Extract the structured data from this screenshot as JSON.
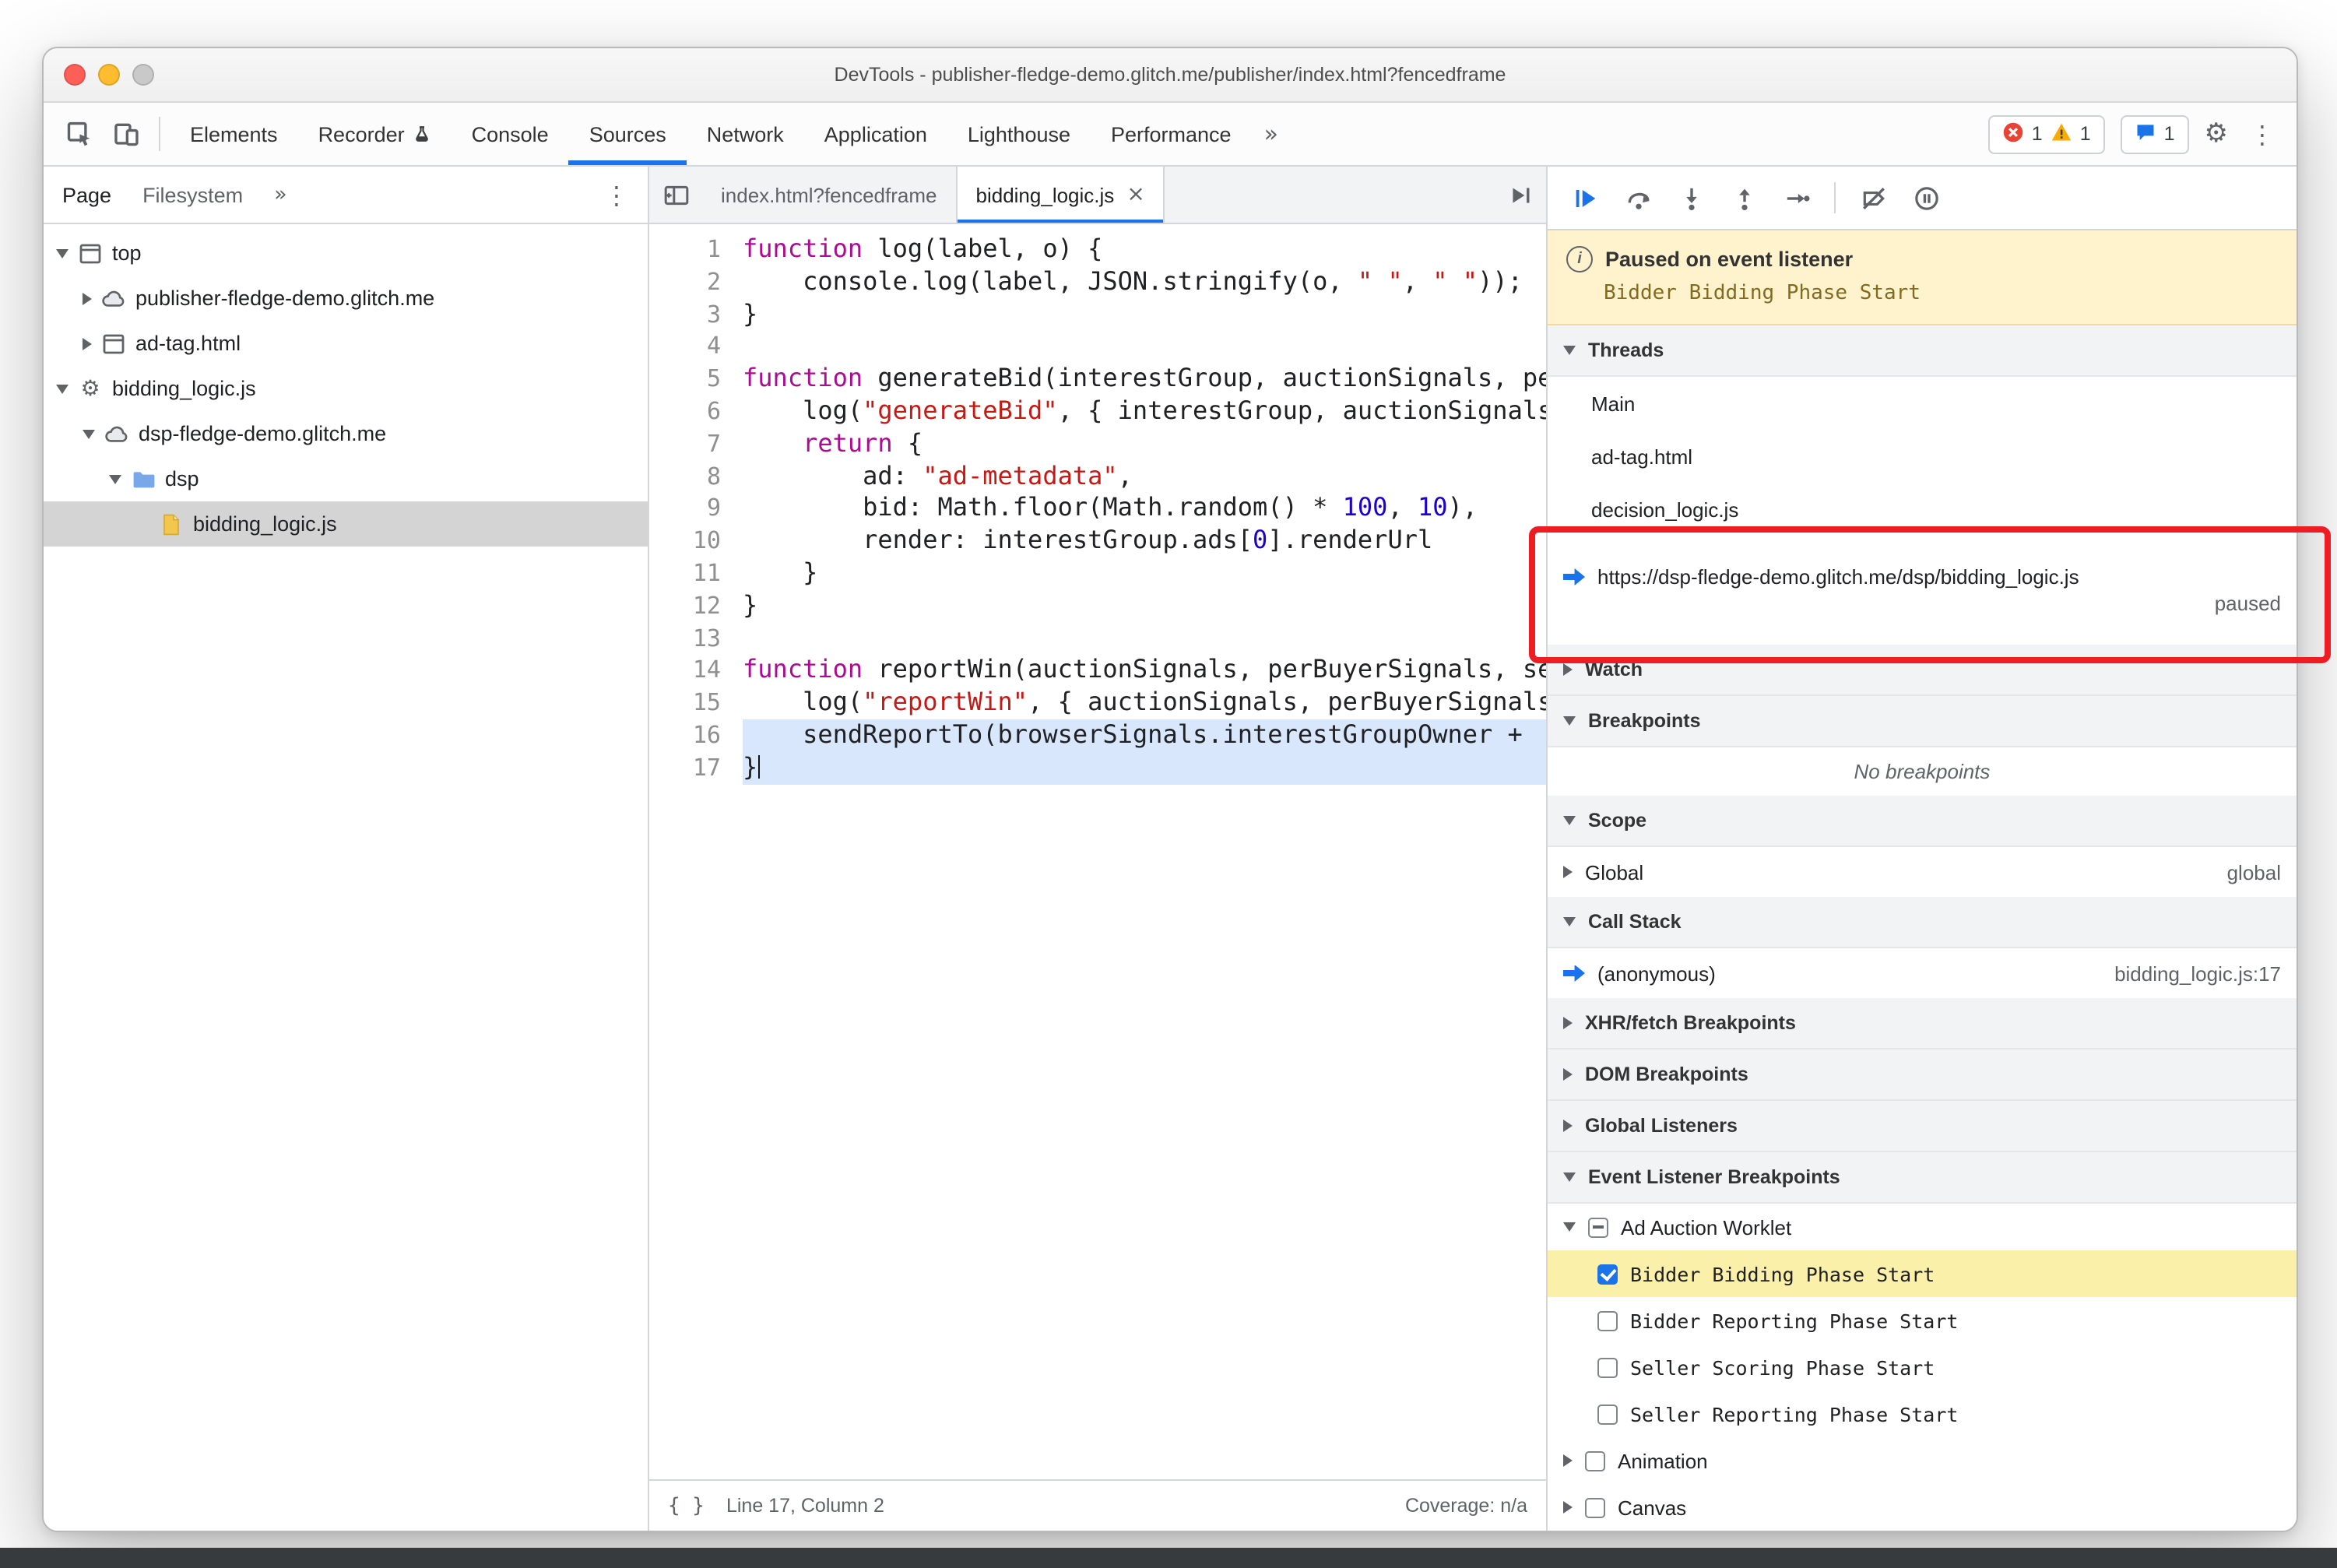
{
  "window": {
    "title": "DevTools - publisher-fledge-demo.glitch.me/publisher/index.html?fencedframe"
  },
  "colors": {
    "accent": "#1a73e8",
    "annotation_red": "#ee1d23",
    "paused_banner_bg": "#fff3cd",
    "highlight_yellow": "#fbf0a9",
    "paused_line_blue": "#d9e7fd"
  },
  "icons": {
    "settings": "⚙",
    "kebab": "⋮",
    "info": "i",
    "close_tab": "×",
    "pretty_print": "{ }"
  },
  "main_toolbar": {
    "tabs": [
      {
        "label": "Elements"
      },
      {
        "label": "Recorder",
        "badge": "flask"
      },
      {
        "label": "Console"
      },
      {
        "label": "Sources",
        "active": true
      },
      {
        "label": "Network"
      },
      {
        "label": "Application"
      },
      {
        "label": "Lighthouse"
      },
      {
        "label": "Performance"
      }
    ],
    "more": "»",
    "errors": "1",
    "warnings": "1",
    "issues": "1"
  },
  "navigator": {
    "tabs": [
      {
        "label": "Page",
        "active": true
      },
      {
        "label": "Filesystem"
      }
    ],
    "more": "»",
    "tree": [
      {
        "label": "top",
        "indent": 0,
        "twisty": "open",
        "icon": "frame"
      },
      {
        "label": "publisher-fledge-demo.glitch.me",
        "indent": 1,
        "twisty": "closed",
        "icon": "cloud"
      },
      {
        "label": "ad-tag.html",
        "indent": 1,
        "twisty": "closed",
        "icon": "frame"
      },
      {
        "label": "bidding_logic.js",
        "indent": 0,
        "twisty": "open",
        "icon": "gear"
      },
      {
        "label": "dsp-fledge-demo.glitch.me",
        "indent": 1,
        "twisty": "open",
        "icon": "cloud"
      },
      {
        "label": "dsp",
        "indent": 2,
        "twisty": "open",
        "icon": "folder"
      },
      {
        "label": "bidding_logic.js",
        "indent": 3,
        "twisty": "none",
        "icon": "file",
        "selected": true
      }
    ]
  },
  "editor": {
    "tabs": [
      {
        "label": "index.html?fencedframe"
      },
      {
        "label": "bidding_logic.js",
        "active": true,
        "closable": true
      }
    ],
    "status": {
      "line_col": "Line 17, Column 2",
      "coverage": "Coverage: n/a"
    },
    "code": [
      {
        "n": 1,
        "tokens": [
          {
            "c": "k",
            "t": "function"
          },
          {
            "c": "p",
            "t": " log(label, o) {"
          }
        ]
      },
      {
        "n": 2,
        "tokens": [
          {
            "c": "p",
            "t": "    console.log(label, JSON.stringify(o, "
          },
          {
            "c": "s",
            "t": "\" \""
          },
          {
            "c": "p",
            "t": ", "
          },
          {
            "c": "s",
            "t": "\" \""
          },
          {
            "c": "p",
            "t": "));"
          }
        ]
      },
      {
        "n": 3,
        "tokens": [
          {
            "c": "p",
            "t": "}"
          }
        ]
      },
      {
        "n": 4,
        "tokens": []
      },
      {
        "n": 5,
        "tokens": [
          {
            "c": "k",
            "t": "function"
          },
          {
            "c": "p",
            "t": " generateBid(interestGroup, auctionSignals, perBuyerSign"
          }
        ]
      },
      {
        "n": 6,
        "tokens": [
          {
            "c": "p",
            "t": "    log("
          },
          {
            "c": "s",
            "t": "\"generateBid\""
          },
          {
            "c": "p",
            "t": ", { interestGroup, auctionSignals, perBu"
          }
        ]
      },
      {
        "n": 7,
        "tokens": [
          {
            "c": "p",
            "t": "    "
          },
          {
            "c": "k",
            "t": "return"
          },
          {
            "c": "p",
            "t": " {"
          }
        ]
      },
      {
        "n": 8,
        "tokens": [
          {
            "c": "p",
            "t": "        ad: "
          },
          {
            "c": "s",
            "t": "\"ad-metadata\""
          },
          {
            "c": "p",
            "t": ","
          }
        ]
      },
      {
        "n": 9,
        "tokens": [
          {
            "c": "p",
            "t": "        bid: Math.floor(Math.random() * "
          },
          {
            "c": "n",
            "t": "100"
          },
          {
            "c": "p",
            "t": ", "
          },
          {
            "c": "n",
            "t": "10"
          },
          {
            "c": "p",
            "t": "),"
          }
        ]
      },
      {
        "n": 10,
        "tokens": [
          {
            "c": "p",
            "t": "        render: interestGroup.ads["
          },
          {
            "c": "n",
            "t": "0"
          },
          {
            "c": "p",
            "t": "].renderUrl"
          }
        ]
      },
      {
        "n": 11,
        "tokens": [
          {
            "c": "p",
            "t": "    }"
          }
        ]
      },
      {
        "n": 12,
        "tokens": [
          {
            "c": "p",
            "t": "}"
          }
        ]
      },
      {
        "n": 13,
        "tokens": []
      },
      {
        "n": 14,
        "tokens": [
          {
            "c": "k",
            "t": "function"
          },
          {
            "c": "p",
            "t": " reportWin(auctionSignals, perBuyerSignals, sellerSig"
          }
        ]
      },
      {
        "n": 15,
        "tokens": [
          {
            "c": "p",
            "t": "    log("
          },
          {
            "c": "s",
            "t": "\"reportWin\""
          },
          {
            "c": "p",
            "t": ", { auctionSignals, perBuyerSignals, sel"
          }
        ]
      },
      {
        "n": 16,
        "hl": true,
        "tokens": [
          {
            "c": "p",
            "t": "    sendReportTo(browserSignals.interestGroupOwner + "
          }
        ]
      },
      {
        "n": 17,
        "hl": true,
        "caret": true,
        "tokens": [
          {
            "c": "p",
            "t": "}"
          }
        ]
      }
    ]
  },
  "debugger": {
    "paused_banner": {
      "title": "Paused on event listener",
      "detail": "Bidder Bidding Phase Start"
    },
    "threads": {
      "title": "Threads",
      "items": [
        {
          "label": "Main"
        },
        {
          "label": "ad-tag.html"
        },
        {
          "label": "decision_logic.js"
        },
        {
          "label": "https://dsp-fledge-demo.glitch.me/dsp/bidding_logic.js",
          "status": "paused",
          "active": true
        }
      ]
    },
    "watch": {
      "title": "Watch"
    },
    "breakpoints": {
      "title": "Breakpoints",
      "empty": "No breakpoints"
    },
    "scope": {
      "title": "Scope",
      "rows": [
        {
          "label": "Global",
          "value": "global"
        }
      ]
    },
    "call_stack": {
      "title": "Call Stack",
      "rows": [
        {
          "label": "(anonymous)",
          "location": "bidding_logic.js:17",
          "active": true
        }
      ]
    },
    "collapsed_sections": [
      "XHR/fetch Breakpoints",
      "DOM Breakpoints",
      "Global Listeners"
    ],
    "event_listener_breakpoints": {
      "title": "Event Listener Breakpoints",
      "items": [
        {
          "label": "Ad Auction Worklet",
          "expanded": true,
          "check": "indeterminate",
          "children": [
            {
              "label": "Bidder Bidding Phase Start",
              "check": "checked",
              "highlighted": true
            },
            {
              "label": "Bidder Reporting Phase Start",
              "check": "unchecked"
            },
            {
              "label": "Seller Scoring Phase Start",
              "check": "unchecked"
            },
            {
              "label": "Seller Reporting Phase Start",
              "check": "unchecked"
            }
          ]
        },
        {
          "label": "Animation",
          "expanded": false,
          "check": "unchecked",
          "children": []
        },
        {
          "label": "Canvas",
          "expanded": false,
          "check": "unchecked",
          "children": []
        }
      ]
    }
  }
}
